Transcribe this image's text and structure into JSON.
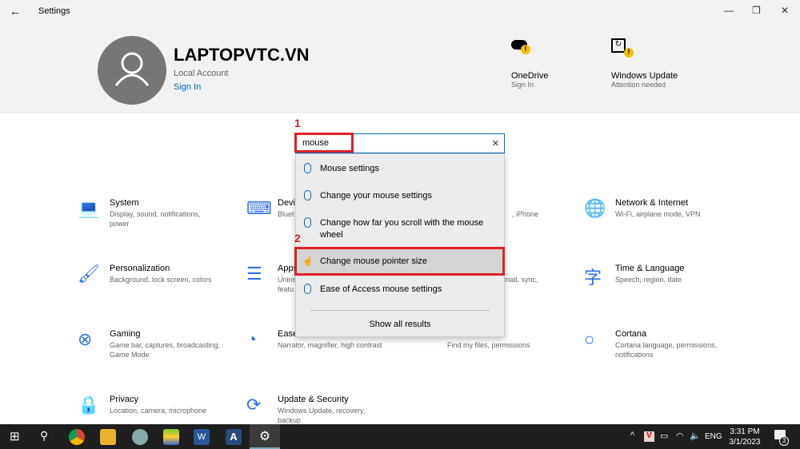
{
  "window": {
    "title": "Settings",
    "back_icon": "back-arrow-icon",
    "minimize": "—",
    "restore": "❐",
    "close": "✕"
  },
  "account": {
    "name": "LAPTOPVTC.VN",
    "type": "Local Account",
    "sign_in": "Sign In"
  },
  "services": [
    {
      "name": "OneDrive",
      "status": "Sign In",
      "icon": "onedrive-icon"
    },
    {
      "name": "Windows Update",
      "status": "Attention needed",
      "icon": "windows-update-icon"
    }
  ],
  "search": {
    "value": "mouse",
    "clear": "✕"
  },
  "suggestions": [
    "Mouse settings",
    "Change your mouse settings",
    "Change how far you scroll with the mouse wheel",
    "Change mouse pointer size",
    "Ease of Access mouse settings"
  ],
  "show_all": "Show all results",
  "annotations": {
    "step1": "1",
    "step2": "2",
    "highlight_color": "#e0202a"
  },
  "tiles": [
    {
      "title": "System",
      "desc": "Display, sound, notifications, power",
      "icon": "laptop-icon"
    },
    {
      "title": "Devices",
      "desc": "Bluet",
      "icon": "keyboard-speaker-icon"
    },
    {
      "title": "Network & Internet",
      "desc": "Wi-Fi, airplane mode, VPN",
      "icon": "globe-icon"
    },
    {
      "title": "Personalization",
      "desc": "Background, lock screen, colors",
      "icon": "paint-icon"
    },
    {
      "title": "Apps",
      "desc": "Unins",
      "desc2": "featu",
      "icon": "apps-list-icon"
    },
    {
      "title": "Time & Language",
      "desc": "Speech, region, date",
      "icon": "time-language-icon"
    },
    {
      "title": "Gaming",
      "desc": "Game bar, captures, broadcasting, Game Mode",
      "icon": "xbox-icon"
    },
    {
      "title": "Ease of Access",
      "desc": "Narrator, magnifier, high contrast",
      "icon": "ease-of-access-icon"
    },
    {
      "title": "Cortana",
      "desc": "Cortana language, permissions, notifications",
      "icon": "cortana-icon"
    },
    {
      "title": "Privacy",
      "desc": "Location, camera, microphone",
      "icon": "lock-icon"
    },
    {
      "title": "Update & Security",
      "desc": "Windows Update, recovery, backup",
      "icon": "sync-icon"
    }
  ],
  "partial": {
    "phone": ", iPhone",
    "accounts": "mail, sync,",
    "search": "Find my files, permissions"
  },
  "taskbar": {
    "lang": "ENG",
    "time": "3:31 PM",
    "date": "3/1/2023",
    "notifications": "3"
  },
  "colors": {
    "accent": "#0067c0",
    "taskbar": "#1f1f1f"
  }
}
